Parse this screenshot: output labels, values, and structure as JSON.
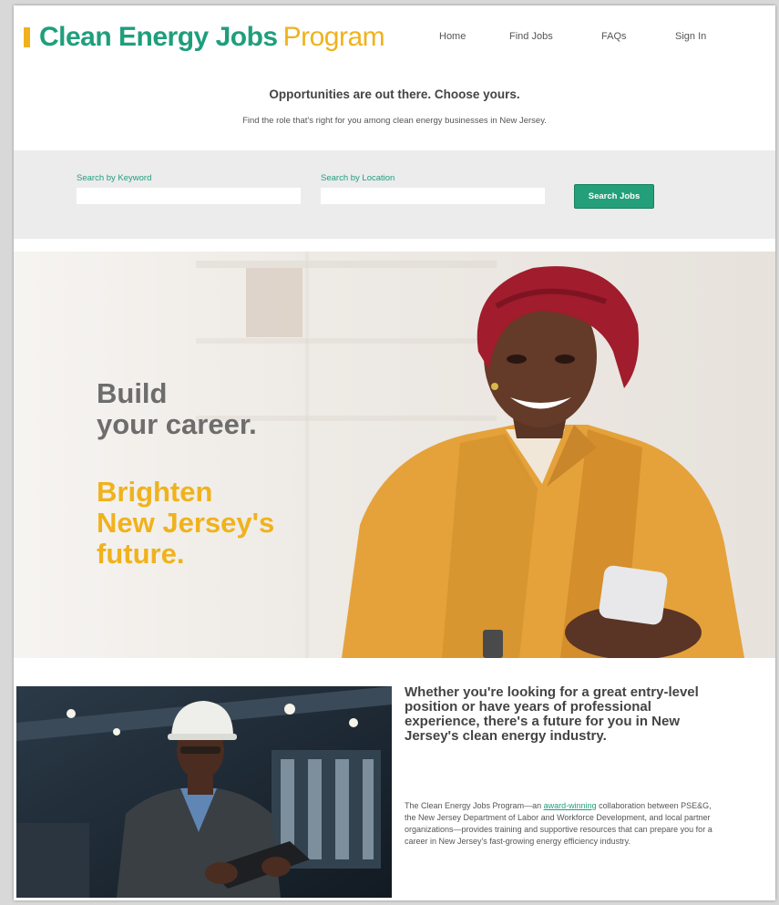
{
  "brand": {
    "name_bold": "Clean Energy Jobs",
    "name_light": "Program",
    "colors": {
      "green": "#1f9e7c",
      "gold": "#f0b21c",
      "gray": "#6d6d6d"
    }
  },
  "nav": {
    "items": [
      {
        "label": "Home"
      },
      {
        "label": "Find Jobs"
      },
      {
        "label": "FAQs"
      },
      {
        "label": "Sign In"
      }
    ]
  },
  "intro": {
    "heading": "Opportunities are out there. Choose yours.",
    "subheading": "Find the role that's right for you among clean energy businesses in New Jersey."
  },
  "search": {
    "keyword_label": "Search by Keyword",
    "keyword_value": "",
    "location_label": "Search by Location",
    "location_value": "",
    "button_label": "Search Jobs"
  },
  "hero": {
    "line1": "Build",
    "line2": "your career.",
    "line3": "Brighten",
    "line4": "New Jersey's",
    "line5": "future."
  },
  "feature": {
    "heading": "Whether you're looking for a great entry-level position or have years of professional experience, there's a future for you in New Jersey's clean energy industry.",
    "body_before": "The Clean Energy Jobs Program—an ",
    "body_link": "award-winning",
    "body_after": " collaboration between PSE&G, the New Jersey Department of Labor and Workforce Development, and local partner organizations—provides training and supportive resources that can prepare you for a career in New Jersey's fast-growing energy efficiency industry."
  }
}
